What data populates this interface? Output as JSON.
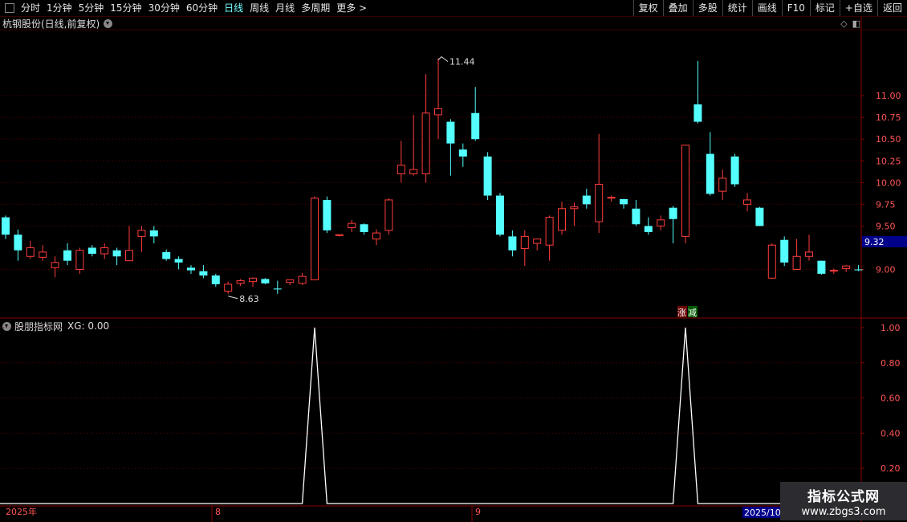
{
  "toolbar": {
    "periods": [
      "分时",
      "1分钟",
      "5分钟",
      "15分钟",
      "30分钟",
      "60分钟",
      "日线",
      "周线",
      "月线",
      "多周期",
      "更多 >"
    ],
    "active_period": "日线",
    "right_buttons": [
      "复权",
      "叠加",
      "多股",
      "统计",
      "画线",
      "F10",
      "标记",
      "+自选",
      "返回"
    ]
  },
  "main": {
    "title": "杭钢股份(日线,前复权)",
    "price_ticks": [
      "11.00",
      "10.75",
      "10.50",
      "10.25",
      "10.00",
      "9.75",
      "9.50",
      "9.00"
    ],
    "current_price": "9.32",
    "high_label": "11.44",
    "low_label": "8.63",
    "tag_up": "涨",
    "tag_down": "减"
  },
  "indicator": {
    "title": "股朋指标网",
    "value_label": "XG: 0.00",
    "ticks": [
      "1.00",
      "0.80",
      "0.60",
      "0.40",
      "0.20"
    ]
  },
  "dates": {
    "year": "2025年",
    "m8": "8",
    "m9": "9",
    "m10": "2025/10"
  },
  "watermark": {
    "line1": "指标公式网",
    "line2": "www.zbgs3.com"
  },
  "colors": {
    "up": "#ff3c3c",
    "down": "#54ffff",
    "grid": "#5a0000",
    "line": "#ffffff"
  },
  "chart_data": {
    "type": "candlestick",
    "ylim": [
      8.45,
      11.75
    ],
    "indicator_ylim": [
      0,
      1.05
    ],
    "candles": [
      [
        9.6,
        9.4,
        9.62,
        9.35
      ],
      [
        9.4,
        9.22,
        9.46,
        9.1
      ],
      [
        9.15,
        9.25,
        9.33,
        9.12
      ],
      [
        9.14,
        9.2,
        9.28,
        9.1
      ],
      [
        9.02,
        9.08,
        9.15,
        8.91
      ],
      [
        9.22,
        9.1,
        9.3,
        9.05
      ],
      [
        9.0,
        9.22,
        9.25,
        8.95
      ],
      [
        9.25,
        9.18,
        9.28,
        9.15
      ],
      [
        9.18,
        9.25,
        9.3,
        9.12
      ],
      [
        9.22,
        9.15,
        9.25,
        9.05
      ],
      [
        9.1,
        9.22,
        9.5,
        9.1
      ],
      [
        9.38,
        9.45,
        9.5,
        9.2
      ],
      [
        9.45,
        9.38,
        9.5,
        9.3
      ],
      [
        9.2,
        9.12,
        9.23,
        9.1
      ],
      [
        9.12,
        9.08,
        9.15,
        9.0
      ],
      [
        9.02,
        8.99,
        9.05,
        8.95
      ],
      [
        8.98,
        8.93,
        9.05,
        8.9
      ],
      [
        8.93,
        8.83,
        8.95,
        8.8
      ],
      [
        8.75,
        8.83,
        8.86,
        8.72
      ],
      [
        8.84,
        8.87,
        8.89,
        8.81
      ],
      [
        8.86,
        8.9,
        8.91,
        8.8
      ],
      [
        8.89,
        8.84,
        8.9,
        8.83
      ],
      [
        8.78,
        8.77,
        8.87,
        8.72
      ],
      [
        8.85,
        8.88,
        8.88,
        8.82
      ],
      [
        8.84,
        8.92,
        8.96,
        8.82
      ],
      [
        8.88,
        9.82,
        9.84,
        8.88
      ],
      [
        9.8,
        9.45,
        9.84,
        9.42
      ],
      [
        9.39,
        9.4,
        9.4,
        9.38
      ],
      [
        9.48,
        9.53,
        9.57,
        9.43
      ],
      [
        9.52,
        9.43,
        9.53,
        9.4
      ],
      [
        9.35,
        9.42,
        9.46,
        9.28
      ],
      [
        9.45,
        9.8,
        9.82,
        9.4
      ],
      [
        10.1,
        10.2,
        10.48,
        10.0
      ],
      [
        10.1,
        10.15,
        10.78,
        10.08
      ],
      [
        10.1,
        10.8,
        11.25,
        10.0
      ],
      [
        10.78,
        10.85,
        11.43,
        10.5
      ],
      [
        10.7,
        10.45,
        10.73,
        10.08
      ],
      [
        10.38,
        10.3,
        10.45,
        10.18
      ],
      [
        10.8,
        10.5,
        11.1,
        10.48
      ],
      [
        10.3,
        9.85,
        10.35,
        9.8
      ],
      [
        9.85,
        9.4,
        9.88,
        9.38
      ],
      [
        9.38,
        9.22,
        9.45,
        9.15
      ],
      [
        9.24,
        9.38,
        9.45,
        9.04
      ],
      [
        9.3,
        9.35,
        9.35,
        9.22
      ],
      [
        9.28,
        9.6,
        9.62,
        9.1
      ],
      [
        9.45,
        9.7,
        9.78,
        9.4
      ],
      [
        9.7,
        9.72,
        9.77,
        9.5
      ],
      [
        9.85,
        9.75,
        9.93,
        9.7
      ],
      [
        9.55,
        9.98,
        10.56,
        9.42
      ],
      [
        9.83,
        9.83,
        9.85,
        9.78
      ],
      [
        9.81,
        9.75,
        9.81,
        9.7
      ],
      [
        9.7,
        9.52,
        9.8,
        9.5
      ],
      [
        9.5,
        9.43,
        9.6,
        9.4
      ],
      [
        9.5,
        9.57,
        9.62,
        9.45
      ],
      [
        9.71,
        9.58,
        9.73,
        9.3
      ],
      [
        9.38,
        10.43,
        10.43,
        9.3
      ],
      [
        10.9,
        10.7,
        11.4,
        10.68
      ],
      [
        10.33,
        9.87,
        10.58,
        9.85
      ],
      [
        9.9,
        10.05,
        10.15,
        9.8
      ],
      [
        10.3,
        9.98,
        10.33,
        9.95
      ],
      [
        9.75,
        9.8,
        9.88,
        9.67
      ],
      [
        9.71,
        9.5,
        9.72,
        9.5
      ],
      [
        8.9,
        9.28,
        9.3,
        8.89
      ],
      [
        9.34,
        9.08,
        9.38,
        9.04
      ],
      [
        9.0,
        9.15,
        9.35,
        9.02
      ],
      [
        9.15,
        9.2,
        9.4,
        9.1
      ],
      [
        9.1,
        8.95,
        9.1,
        8.94
      ],
      [
        8.98,
        8.99,
        9.01,
        8.95
      ],
      [
        9.01,
        9.04,
        9.05,
        8.97
      ],
      [
        9.0,
        8.99,
        9.05,
        8.98
      ]
    ],
    "xg_signal_candles": [
      25,
      55
    ]
  }
}
